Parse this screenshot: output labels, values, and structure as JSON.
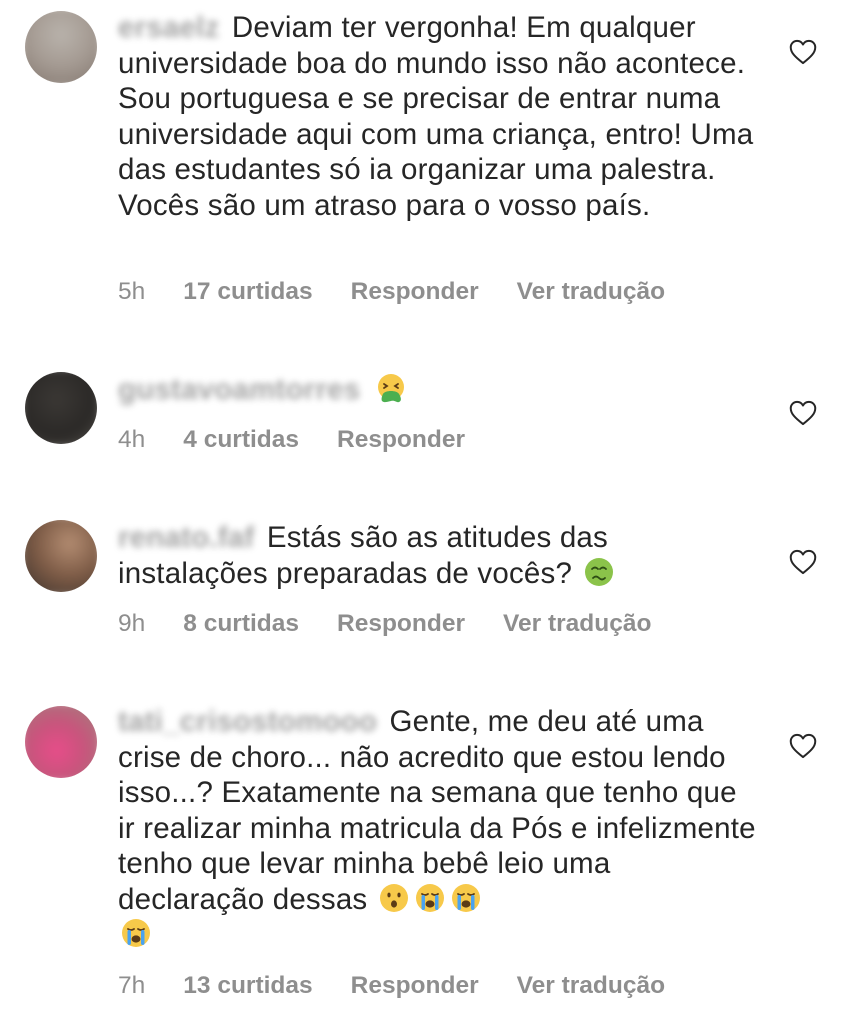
{
  "comments": [
    {
      "username": "ersaelz",
      "text": "Deviam ter vergonha! Em qualquer universidade boa do mundo isso não acontece. Sou portuguesa e se precisar de entrar numa universidade aqui com uma criança, entro! Uma das estudantes só ia organizar uma palestra. Vocês são um atraso para o vosso país.",
      "time": "5h",
      "likes": "17 curtidas",
      "reply": "Responder",
      "translate": "Ver tradução"
    },
    {
      "username": "gustavoamtorres",
      "text": "",
      "emojis": [
        "vomiting-face-emoji"
      ],
      "time": "4h",
      "likes": "4 curtidas",
      "reply": "Responder"
    },
    {
      "username": "renato.faf",
      "text": "Estás são as atitudes das instalações preparadas de vocês?",
      "emojis": [
        "nauseated-face-emoji"
      ],
      "time": "9h",
      "likes": "8 curtidas",
      "reply": "Responder",
      "translate": "Ver tradução"
    },
    {
      "username": "tati_crisostomooo",
      "text": "Gente, me deu até uma crise de choro... não acredito que estou lendo isso...? Exatamente na semana que tenho que ir realizar minha matricula da Pós e infelizmente tenho que levar minha bebê leio uma declaração dessas",
      "emojis": [
        "hushed-face-emoji",
        "crying-face-emoji",
        "crying-face-emoji",
        "crying-face-emoji"
      ],
      "time": "7h",
      "likes": "13 curtidas",
      "reply": "Responder",
      "translate": "Ver tradução"
    }
  ],
  "colors": {
    "text": "#262626",
    "meta": "#8e8e8e",
    "background": "#ffffff"
  }
}
